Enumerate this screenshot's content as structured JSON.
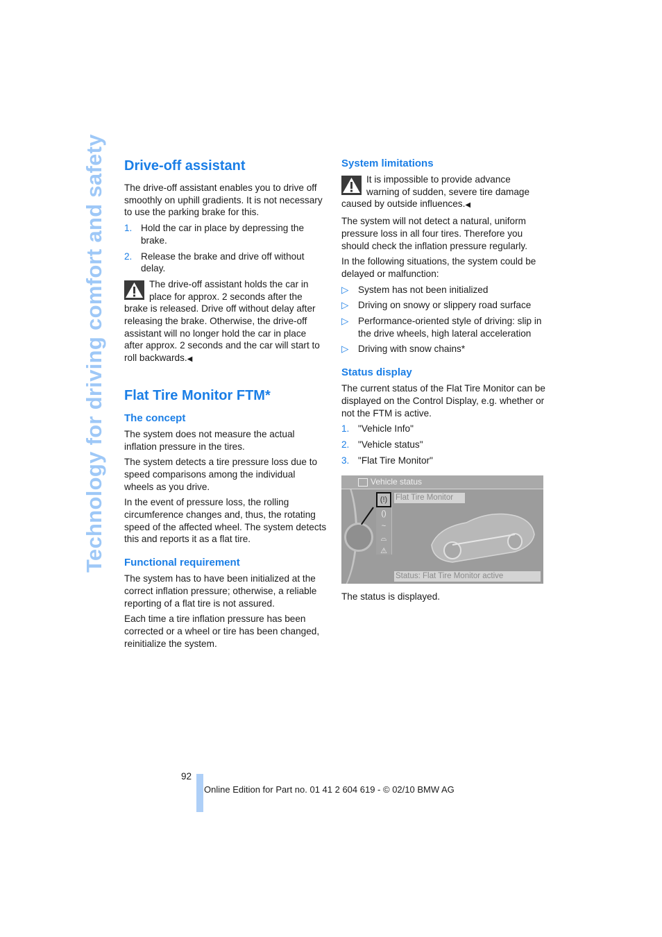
{
  "side_title": "Technology for driving comfort and safety",
  "left_column": {
    "drive_off": {
      "title": "Drive-off assistant",
      "intro": "The drive-off assistant enables you to drive off smoothly on uphill gradients. It is not necessary to use the parking brake for this.",
      "steps": [
        {
          "num": "1.",
          "text": "Hold the car in place by depressing the brake."
        },
        {
          "num": "2.",
          "text": "Release the brake and drive off without delay."
        }
      ],
      "warning": "The drive-off assistant holds the car in place for approx. 2 seconds after the brake is released. Drive off without delay after releasing the brake. Otherwise, the drive-off assistant will no longer hold the car in place after approx. 2 seconds and the car will start to roll backwards.",
      "end_mark": "◀"
    },
    "ftm": {
      "title": "Flat Tire Monitor FTM*",
      "concept_title": "The concept",
      "concept_p1": "The system does not measure the actual inflation pressure in the tires.",
      "concept_p2": "The system detects a tire pressure loss due to speed comparisons among the individual wheels as you drive.",
      "concept_p3": "In the event of pressure loss, the rolling circumference changes and, thus, the rotating speed of the affected wheel. The system detects this and reports it as a flat tire.",
      "func_title": "Functional requirement",
      "func_p1": "The system has to have been initialized at the correct inflation pressure; otherwise, a reliable reporting of a flat tire is not assured.",
      "func_p2": "Each time a tire inflation pressure has been corrected or a wheel or tire has been changed, reinitialize the system."
    }
  },
  "right_column": {
    "limits_title": "System limitations",
    "limits_warning": "It is impossible to provide advance warning of sudden, severe tire damage caused by outside influences.",
    "end_mark": "◀",
    "limits_p1": "The system will not detect a natural, uniform pressure loss in all four tires. Therefore you should check the inflation pressure regularly.",
    "limits_p2": "In the following situations, the system could be delayed or malfunction:",
    "bullet_glyph": "▷",
    "bullets": [
      "System has not been initialized",
      "Driving on snowy or slippery road surface",
      "Performance-oriented style of driving: slip in the drive wheels, high lateral acceleration",
      "Driving with snow chains*"
    ],
    "status_title": "Status display",
    "status_p1": "The current status of the Flat Tire Monitor can be displayed on the Control Display, e.g. whether or not the FTM is active.",
    "status_steps": [
      {
        "num": "1.",
        "text": "\"Vehicle Info\""
      },
      {
        "num": "2.",
        "text": "\"Vehicle status\""
      },
      {
        "num": "3.",
        "text": "\"Flat Tire Monitor\""
      }
    ],
    "screen": {
      "title": "Vehicle status",
      "menu_item": "Flat Tire Monitor",
      "status_line": "Status: Flat Tire Monitor active",
      "icons": [
        "tire-pressure-icon",
        "tire-icon",
        "oil-icon",
        "car-icon",
        "warning-icon"
      ]
    },
    "status_after": "The status is displayed."
  },
  "footer": {
    "page_number": "92",
    "text": "Online Edition for Part no. 01 41 2 604 619 - © 02/10 BMW AG"
  },
  "colors": {
    "heading_blue": "#1a7ee6",
    "side_title_blue": "#9ec8f7",
    "footer_bar": "#aecff7"
  }
}
